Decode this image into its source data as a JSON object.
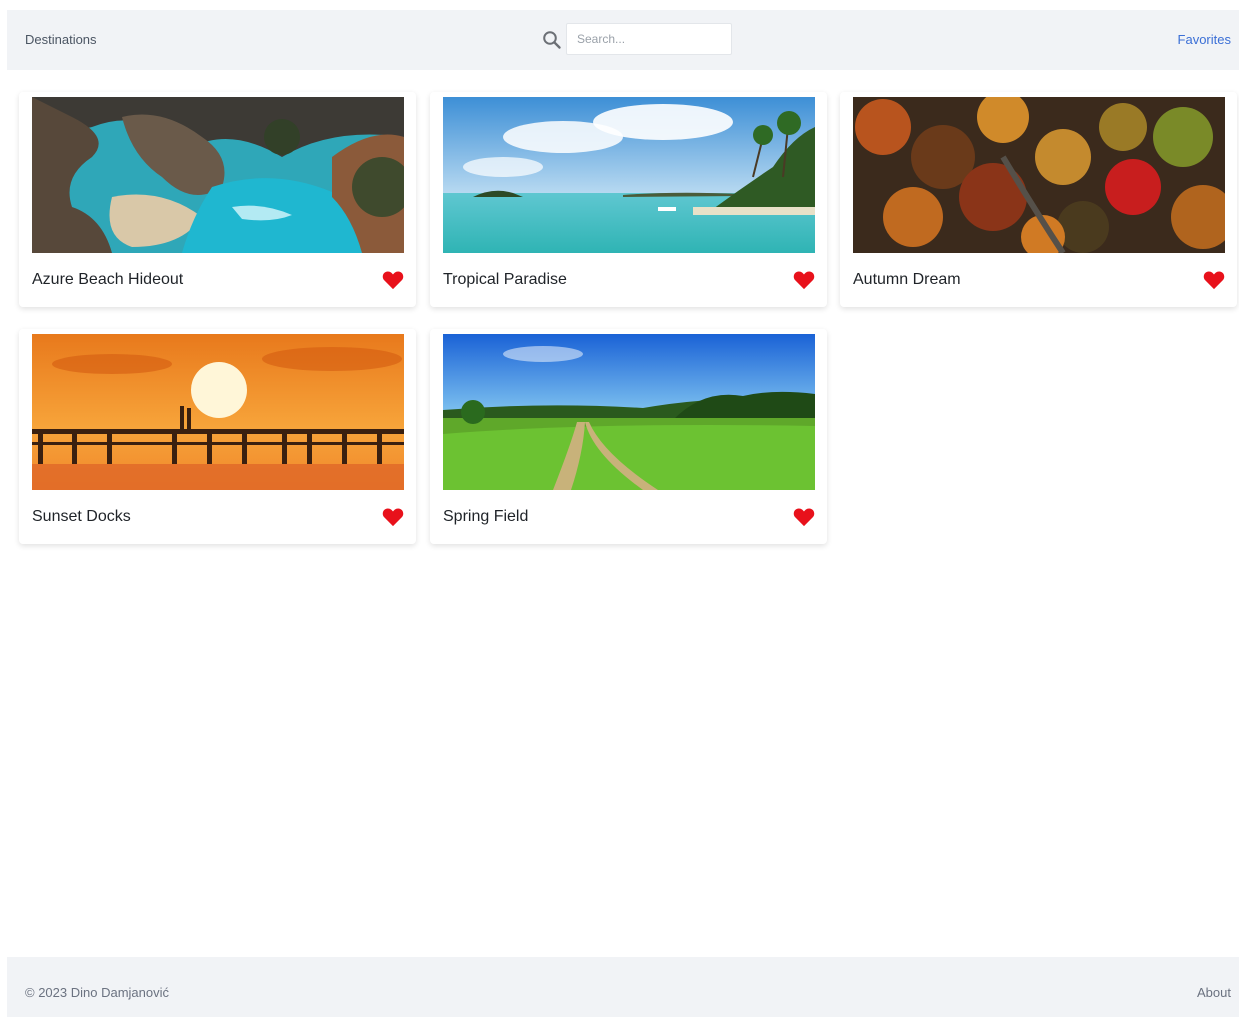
{
  "header": {
    "brand": "Destinations",
    "search": {
      "placeholder": "Search...",
      "value": ""
    },
    "favorites_label": "Favorites"
  },
  "cards": [
    {
      "title": "Azure Beach Hideout",
      "favorited": true
    },
    {
      "title": "Tropical Paradise",
      "favorited": true
    },
    {
      "title": "Autumn Dream",
      "favorited": true
    },
    {
      "title": "Sunset Docks",
      "favorited": true
    },
    {
      "title": "Spring Field",
      "favorited": true
    }
  ],
  "footer": {
    "copyright": "© 2023 Dino Damjanović",
    "about_label": "About"
  },
  "colors": {
    "heart": "#e8111b",
    "link": "#3b6fd6",
    "bar_bg": "#f1f3f6"
  }
}
